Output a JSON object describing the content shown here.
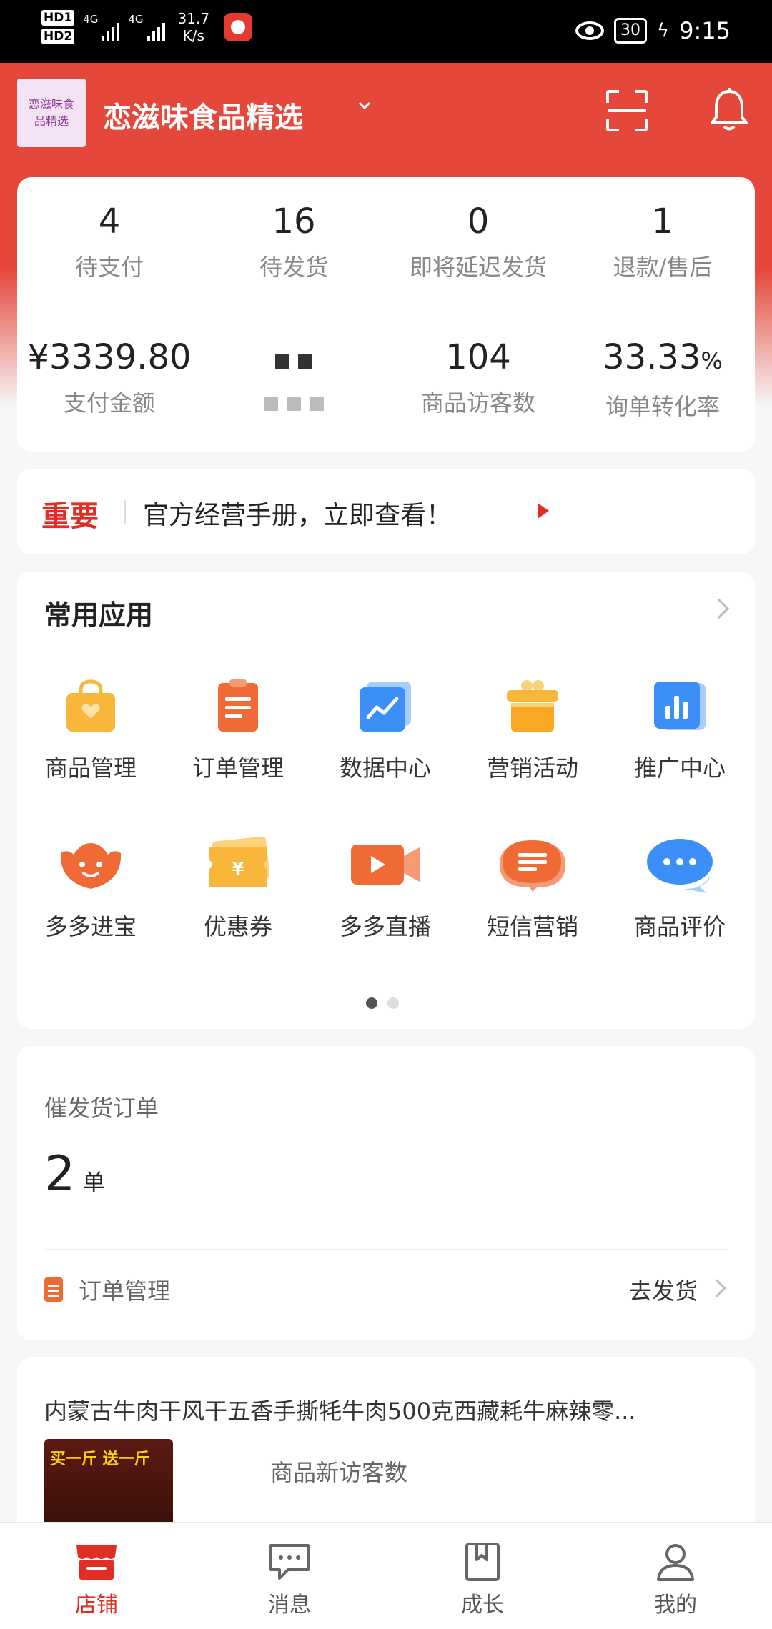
{
  "status_bar": {
    "hd1": "HD1",
    "hd2": "HD2",
    "net1": "4G",
    "net2": "4G",
    "speed_value": "31.7",
    "speed_unit": "K/s",
    "battery": "30",
    "time": "9:15"
  },
  "header": {
    "logo_line1": "恋滋味食",
    "logo_line2": "品精选",
    "shop_name": "恋滋味食品精选"
  },
  "stats": {
    "row1": [
      {
        "value": "4",
        "label": "待支付"
      },
      {
        "value": "16",
        "label": "待发货"
      },
      {
        "value": "0",
        "label": "即将延迟发货"
      },
      {
        "value": "1",
        "label": "退款/售后"
      }
    ],
    "row2": [
      {
        "value": "¥3339.80",
        "label": "支付金额"
      },
      {
        "value": "",
        "label": ""
      },
      {
        "value": "104",
        "label": "商品访客数"
      },
      {
        "value": "33.33",
        "unit": "%",
        "label": "询单转化率"
      }
    ]
  },
  "notice": {
    "tag": "重要",
    "text": "官方经营手册，立即查看！"
  },
  "apps": {
    "title": "常用应用",
    "items": [
      {
        "label": "商品管理",
        "icon": "shopping-bag-icon",
        "color": "#f8b73a"
      },
      {
        "label": "订单管理",
        "icon": "clipboard-icon",
        "color": "#f06a35"
      },
      {
        "label": "数据中心",
        "icon": "chart-line-icon",
        "color": "#3b8ff6"
      },
      {
        "label": "营销活动",
        "icon": "gift-icon",
        "color": "#f8b73a"
      },
      {
        "label": "推广中心",
        "icon": "bar-chart-icon",
        "color": "#3b8ff6"
      },
      {
        "label": "多多进宝",
        "icon": "ingot-icon",
        "color": "#f06a35"
      },
      {
        "label": "优惠券",
        "icon": "coupon-icon",
        "color": "#f8b73a"
      },
      {
        "label": "多多直播",
        "icon": "video-icon",
        "color": "#f06a35"
      },
      {
        "label": "短信营销",
        "icon": "message-icon",
        "color": "#f06a35"
      },
      {
        "label": "商品评价",
        "icon": "chat-icon",
        "color": "#3b8ff6"
      }
    ]
  },
  "urge": {
    "title": "催发货订单",
    "count": "2",
    "unit": "单",
    "link_label": "订单管理",
    "action": "去发货"
  },
  "product": {
    "title": "内蒙古牛肉干风干五香手撕牦牛肉500克西藏耗牛麻辣零...",
    "image_text": "买一斤 送一斤",
    "metric_label": "商品新访客数"
  },
  "tabs": [
    {
      "label": "店铺",
      "icon": "store-icon",
      "active": true
    },
    {
      "label": "消息",
      "icon": "message-bubble-icon",
      "active": false
    },
    {
      "label": "成长",
      "icon": "bookmark-book-icon",
      "active": false
    },
    {
      "label": "我的",
      "icon": "person-icon",
      "active": false
    }
  ],
  "colors": {
    "brand_red": "#e5473a",
    "accent_red": "#e02e24"
  }
}
